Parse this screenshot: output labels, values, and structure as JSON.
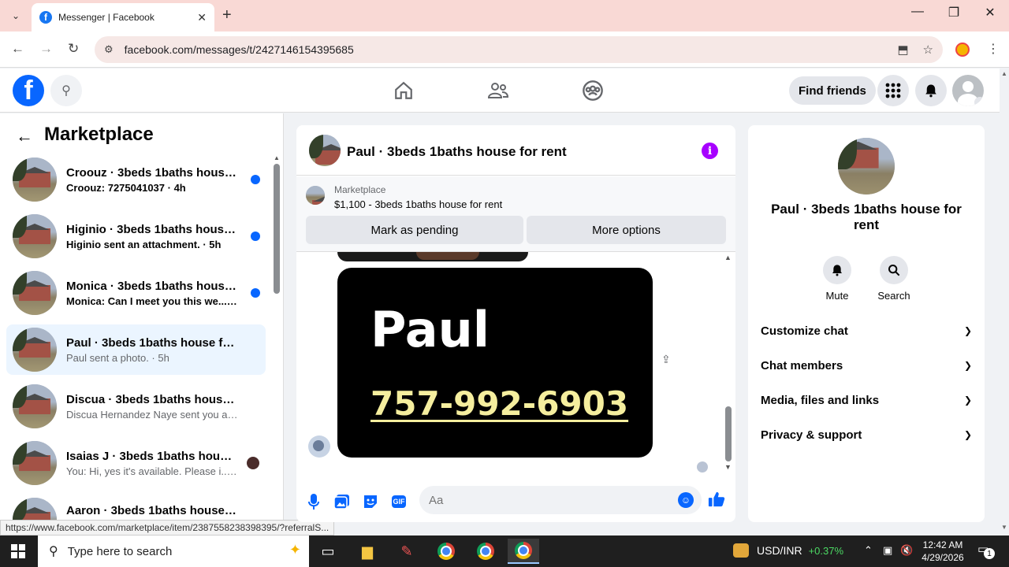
{
  "browser": {
    "tab_title": "Messenger | Facebook",
    "url": "facebook.com/messages/t/2427146154395685",
    "status_link": "https://www.facebook.com/marketplace/item/2387558238398395/?referralS..."
  },
  "fb": {
    "find_friends": "Find friends"
  },
  "left": {
    "title": "Marketplace",
    "conversations": [
      {
        "name": "Croouz · 3beds 1baths house f...",
        "preview": "Croouz: 7275041037 · 4h",
        "unread": true
      },
      {
        "name": "Higinio · 3beds 1baths house f...",
        "preview": "Higinio sent an attachment. · 5h",
        "unread": true
      },
      {
        "name": "Monica · 3beds 1baths house f...",
        "preview": "Monica: Can I meet you this we... · 5h",
        "unread": true
      },
      {
        "name": "Paul · 3beds 1baths house for rent",
        "preview": "Paul sent a photo. · 5h",
        "unread": false
      },
      {
        "name": "Discua · 3beds 1baths house for ...",
        "preview": "Discua Hernandez Naye sent you a ... · 6h",
        "unread": false
      },
      {
        "name": "Isaias J · 3beds 1baths house f...",
        "preview": "You: Hi, yes it's available. Please i... · 6h",
        "unread": false
      },
      {
        "name": "Aaron · 3beds 1baths house for r...",
        "preview": "",
        "unread": false
      }
    ]
  },
  "chat": {
    "title": "Paul · 3beds 1baths house for rent",
    "marketplace_label": "Marketplace",
    "listing": "$1,100 - 3beds 1baths house for rent",
    "mark_pending": "Mark as pending",
    "more_options": "More options",
    "photo_name": "Paul",
    "photo_phone": "757-992-6903",
    "input_placeholder": "Aa",
    "gif_label": "GIF"
  },
  "right": {
    "name": "Paul · 3beds 1baths house for rent",
    "mute": "Mute",
    "search": "Search",
    "rows": [
      "Customize chat",
      "Chat members",
      "Media, files and links",
      "Privacy & support"
    ]
  },
  "taskbar": {
    "search_placeholder": "Type here to search",
    "ticker": "USD/INR",
    "ticker_change": "+0.37%",
    "time": "12:42 AM",
    "date": "4/29/2026",
    "notif_count": "1"
  },
  "colors": {
    "fb_blue": "#0866ff",
    "info_purple": "#a700ff",
    "active_row": "#ebf5ff",
    "phone_yellow": "#f5ee9e"
  },
  "icons": [
    "home-icon",
    "friends-icon",
    "groups-icon",
    "menu-grid-icon",
    "bell-icon",
    "info-icon",
    "mic-icon",
    "photo-icon",
    "sticker-icon",
    "gif-icon",
    "emoji-icon",
    "like-icon"
  ]
}
